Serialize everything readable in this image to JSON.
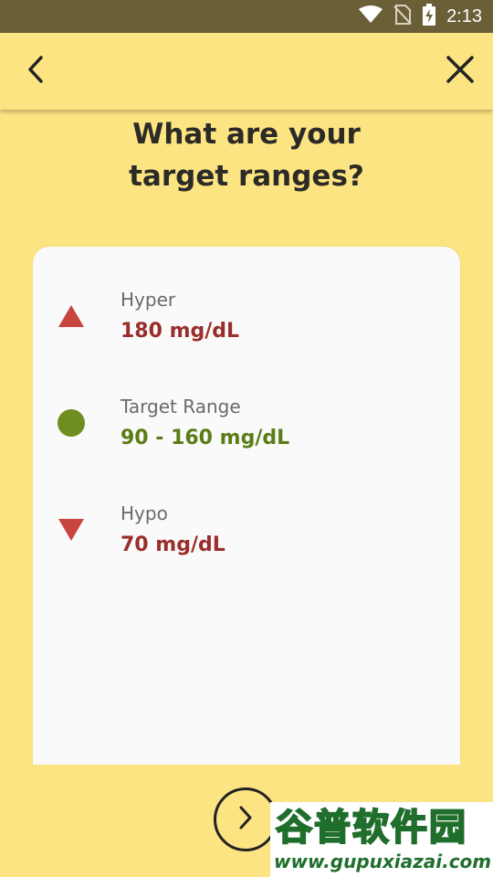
{
  "status_bar": {
    "time": "2:13",
    "icons": [
      "wifi-icon",
      "no-sim-icon",
      "battery-charging-icon"
    ]
  },
  "app_bar": {
    "back_icon": "chevron-left-icon",
    "close_icon": "close-icon"
  },
  "heading": {
    "line1": "What are your",
    "line2": "target ranges?"
  },
  "ranges": [
    {
      "label": "Hyper",
      "value": "180 mg/dL",
      "icon": "triangle-up-icon",
      "color": "#c9433f",
      "value_color": "#9a2e2c"
    },
    {
      "label": "Target Range",
      "value": "90 - 160 mg/dL",
      "icon": "circle-icon",
      "color": "#6e8f1f",
      "value_color": "#5b7d16"
    },
    {
      "label": "Hypo",
      "value": "70 mg/dL",
      "icon": "triangle-down-icon",
      "color": "#c9433f",
      "value_color": "#9a2e2c"
    }
  ],
  "next_button": {
    "icon": "chevron-right-icon"
  },
  "watermark": {
    "title": "谷普软件园",
    "url": "www.gupuxiazai.com"
  },
  "colors": {
    "background": "#fde482",
    "status_bar": "#6b5f38",
    "card": "#fafafa",
    "heading_text": "#2b2a26"
  }
}
